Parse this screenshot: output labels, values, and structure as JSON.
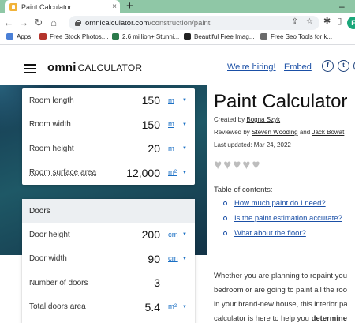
{
  "browser": {
    "tab_title": "Paint Calculator",
    "tab_close": "×",
    "new_tab": "+",
    "url_host": "omnicalculator.com",
    "url_path": "/construction/paint",
    "profile_initial": "F",
    "bookmarks": [
      {
        "label": "Apps",
        "color": "#4a7fd6"
      },
      {
        "label": "Free Stock Photos,...",
        "color": "#b4342c"
      },
      {
        "label": "2.6 million+ Stunni...",
        "color": "#2c7a4b"
      },
      {
        "label": "Beautiful Free Imag...",
        "color": "#222222"
      },
      {
        "label": "Free Seo Tools for k...",
        "color": "#6b6b6b"
      }
    ]
  },
  "site": {
    "logo_omni": "omni",
    "logo_calculator": "CALCULATOR",
    "hiring": "We’re hiring!",
    "embed": "Embed",
    "social": [
      "f",
      "t",
      "in"
    ]
  },
  "calculator": {
    "room": [
      {
        "label": "Room length",
        "value": "150",
        "unit": "m"
      },
      {
        "label": "Room width",
        "value": "150",
        "unit": "m"
      },
      {
        "label": "Room height",
        "value": "20",
        "unit": "m"
      },
      {
        "label": "Room surface area",
        "value": "12,000",
        "unit": "m²"
      }
    ],
    "doors_header": "Doors",
    "doors": [
      {
        "label": "Door height",
        "value": "200",
        "unit": "cm"
      },
      {
        "label": "Door width",
        "value": "90",
        "unit": "cm"
      },
      {
        "label": "Number of doors",
        "value": "3",
        "unit": ""
      },
      {
        "label": "Total doors area",
        "value": "5.4",
        "unit": "m²"
      }
    ]
  },
  "article": {
    "title": "Paint Calculator",
    "created_prefix": "Created by",
    "created_by": "Bogna Szyk",
    "reviewed_prefix": "Reviewed by",
    "reviewer1": "Steven Wooding",
    "reviewed_and": "and",
    "reviewer2": "Jack Bowat",
    "last_updated": "Last updated: Mar 24, 2022",
    "rating_icons": 5,
    "toc_title": "Table of contents:",
    "toc": [
      "How much paint do I need?",
      "Is the paint estimation accurate?",
      "What about the floor?"
    ],
    "para_lines": [
      "Whether you are planning to repaint you",
      "bedroom or are going to paint all the roo",
      "in your brand-new house, this interior pa",
      "calculator is here to help you"
    ],
    "para_bold": "determine"
  }
}
